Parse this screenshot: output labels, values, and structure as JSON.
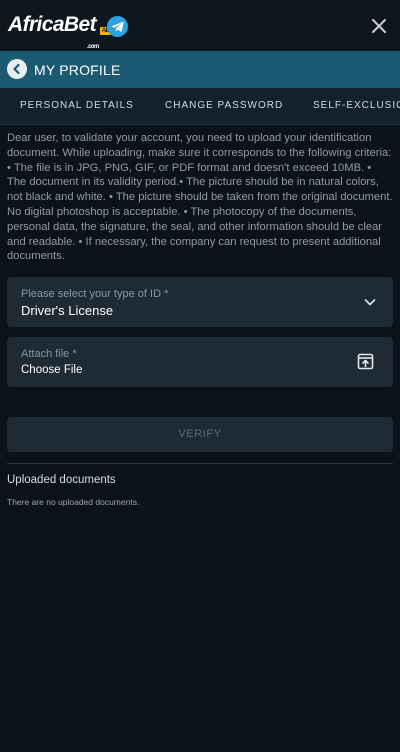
{
  "header": {
    "logo_text": "AfricaBet",
    "logo_suffix": ".com",
    "logo_badge": "AB",
    "telegram_icon": "telegram-icon",
    "close_icon": "close-icon"
  },
  "profile_bar": {
    "title": "MY PROFILE",
    "back_icon": "back-arrow-icon"
  },
  "tabs": [
    {
      "label": "PERSONAL DETAILS"
    },
    {
      "label": "CHANGE PASSWORD"
    },
    {
      "label": "SELF-EXCLUSION"
    }
  ],
  "info_text": "Dear user, to validate your account, you need to upload your identification document. While uploading, make sure it corresponds to the following criteria: • The file is in JPG, PNG, GIF, or PDF format and doesn't exceed 10MB. • The document in its validity period.• The picture should be in natural colors, not black and white. • The picture should be taken from the original document. No digital photoshop is acceptable. • The photocopy of the documents, personal data, the signature, the seal, and other information should be clear and readable. • If necessary, the company can request to present additional documents.",
  "form": {
    "id_type": {
      "label": "Please select your type of ID *",
      "value": "Driver's License",
      "icon": "chevron-down-icon"
    },
    "attach_file": {
      "label": "Attach file *",
      "value": "Choose File",
      "icon": "upload-icon"
    },
    "verify_label": "VERIFY"
  },
  "uploaded": {
    "title": "Uploaded documents",
    "empty_message": "There are no uploaded documents."
  },
  "colors": {
    "background": "#0a131b",
    "profile_bar": "#1b5a72",
    "field_bg": "#1e2a34",
    "telegram": "#2aa3df",
    "badge": "#f5b800"
  }
}
